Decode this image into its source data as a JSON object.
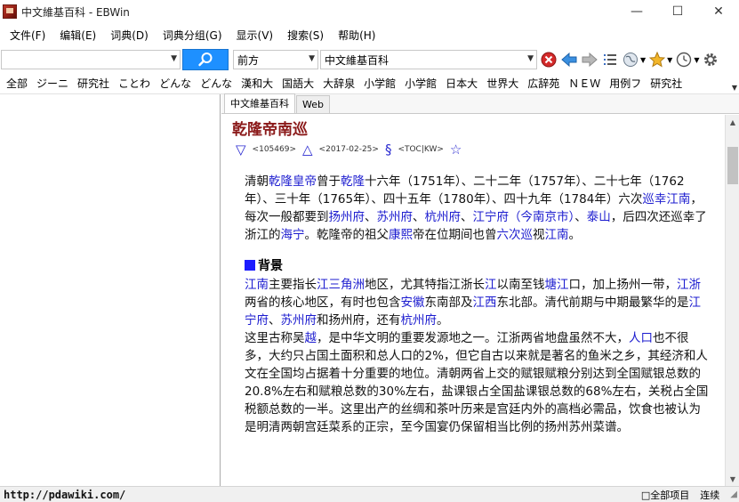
{
  "window": {
    "title": "中文維基百科 - EBWin",
    "minimize": "—",
    "maximize": "☐",
    "close": "✕"
  },
  "menu": [
    {
      "label": "文件(F)"
    },
    {
      "label": "编辑(E)"
    },
    {
      "label": "词典(D)"
    },
    {
      "label": "词典分组(G)"
    },
    {
      "label": "显示(V)"
    },
    {
      "label": "搜索(S)"
    },
    {
      "label": "帮助(H)"
    }
  ],
  "search": {
    "query": "",
    "mode": "前方",
    "dictionary": "中文維基百科"
  },
  "dict_bar": [
    "全部",
    "ジーニ",
    "研究社",
    "ことわ",
    "どんな",
    "どんな",
    "漢和大",
    "国語大",
    "大辞泉",
    "小学館",
    "小学館",
    "日本大",
    "世界大",
    "広辞苑",
    "ＮＥＷ",
    "用例フ",
    "研究社"
  ],
  "tabs": [
    {
      "label": "中文維基百科"
    },
    {
      "label": "Web"
    }
  ],
  "entry": {
    "title": "乾隆帝南巡",
    "meta": {
      "down": "▽",
      "id": "<105469>",
      "up": "△",
      "date": "<2017-02-25>",
      "mark": "§",
      "tag": "<TOC|KW>",
      "star": "☆"
    },
    "para1": [
      {
        "t": "清朝"
      },
      {
        "t": "乾隆皇帝",
        "link": true
      },
      {
        "t": "曾于"
      },
      {
        "t": "乾隆",
        "link": true
      },
      {
        "t": "十六年（1751年）、二十二年（1757年）、二十七年（1762年）、三十年（1765年）、四十五年（1780年）、四十九年（1784年）六次"
      },
      {
        "t": "巡幸",
        "link": true
      },
      {
        "t": "江南",
        "link": true
      },
      {
        "t": "，每次一般都要到"
      },
      {
        "t": "扬州府",
        "link": true
      },
      {
        "t": "、"
      },
      {
        "t": "苏州府",
        "link": true
      },
      {
        "t": "、"
      },
      {
        "t": "杭州府",
        "link": true
      },
      {
        "t": "、"
      },
      {
        "t": "江宁府（今南京市）",
        "link": true
      },
      {
        "t": "、"
      },
      {
        "t": "泰山",
        "link": true
      },
      {
        "t": "，后四次还巡幸了浙江的"
      },
      {
        "t": "海宁",
        "link": true
      },
      {
        "t": "。乾隆帝的祖父"
      },
      {
        "t": "康熙",
        "link": true
      },
      {
        "t": "帝在位期间也曾"
      },
      {
        "t": "六次巡",
        "link": true
      },
      {
        "t": "视"
      },
      {
        "t": "江南",
        "link": true
      },
      {
        "t": "。"
      }
    ],
    "section": "背景",
    "para2": [
      {
        "t": "江南",
        "link": true
      },
      {
        "t": "主要指长"
      },
      {
        "t": "江三角洲",
        "link": true
      },
      {
        "t": "地区，尤其特指江浙长"
      },
      {
        "t": "江",
        "link": true
      },
      {
        "t": "以南至钱"
      },
      {
        "t": "塘江",
        "link": true
      },
      {
        "t": "口，加上扬州一带，"
      },
      {
        "t": "江浙",
        "link": true
      },
      {
        "t": "两省的核心地区，有时也包含"
      },
      {
        "t": "安徽",
        "link": true
      },
      {
        "t": "东南部及"
      },
      {
        "t": "江西",
        "link": true
      },
      {
        "t": "东北部。清代前期与中期最繁华的是"
      },
      {
        "t": "江宁府",
        "link": true
      },
      {
        "t": "、"
      },
      {
        "t": "苏州府",
        "link": true
      },
      {
        "t": "和扬州府，还有"
      },
      {
        "t": "杭州府",
        "link": true
      },
      {
        "t": "。"
      }
    ],
    "para3": [
      {
        "t": "这里古称吴"
      },
      {
        "t": "越",
        "link": true
      },
      {
        "t": "，是中华文明的重要发源地之一。江浙两省地盘虽然不大，"
      },
      {
        "t": "人口",
        "link": true
      },
      {
        "t": "也不很多，大约只占国土面积和总人口的2%，但它自古以来就是著名的鱼米之乡，其经济和人文在全国均占据着十分重要的地位。清朝两省上交的赋银赋粮分别达到全国赋银总数的20.8%左右和赋粮总数的30%左右，盐课银占全国盐课银总数的68%左右，关税占全国税额总数的一半。这里出产的丝绸和茶叶历来是宫廷内外的高档必需品，饮食也被认为是明清两朝宫廷菜系的正宗，至今国宴仍保留相当比例的扬州苏州菜谱。"
      }
    ]
  },
  "status": {
    "watermark": "http://pdawiki.com/",
    "all_items": "□全部项目",
    "continuous": "连续",
    "grip": "◢"
  }
}
